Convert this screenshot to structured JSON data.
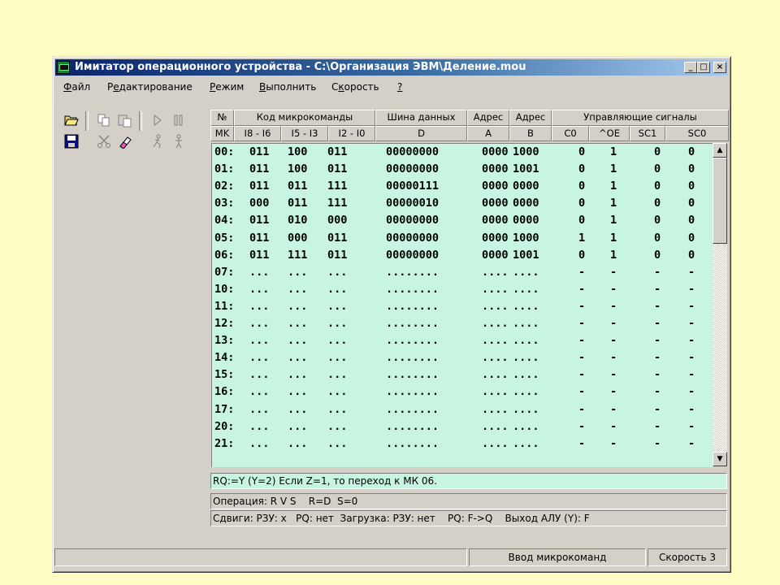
{
  "window": {
    "title": "Имитатор операционного устройства - C:\\Организация ЭВМ\\Деление.mou",
    "minimize": "_",
    "maximize": "□",
    "close": "×"
  },
  "menu": [
    {
      "accel": "Ф",
      "rest": "айл"
    },
    {
      "accel": "",
      "pre": "Р",
      "u": "е",
      "rest": "дактирование"
    },
    {
      "accel": "Р",
      "rest": "ежим"
    },
    {
      "accel": "В",
      "rest": "ыполнить"
    },
    {
      "accel": "",
      "pre": "С",
      "u": "к",
      "rest": "орость"
    },
    {
      "accel": "?",
      "rest": ""
    }
  ],
  "toolbar": {
    "icons": [
      "open-folder-icon",
      "copy-icon",
      "paste-icon",
      "play-icon",
      "pause-icon",
      "save-icon",
      "cut-icon",
      "eraser-icon",
      "step-icon",
      "step-back-icon"
    ]
  },
  "headers": {
    "row1": [
      "№",
      "Код микрокоманды",
      "Шина данных",
      "Адрес",
      "Адрес",
      "Управляющие сигналы"
    ],
    "row2": [
      "MK",
      "I8 - I6",
      "I5 - I3",
      "I2 - I0",
      "D",
      "A",
      "B",
      "C0",
      "^OE",
      "SC1",
      "SC0"
    ]
  },
  "rows": [
    [
      "00:",
      "011",
      "100",
      "011",
      "00000000",
      "0000",
      "1000",
      "0",
      "1",
      "0",
      "0"
    ],
    [
      "01:",
      "011",
      "100",
      "011",
      "00000000",
      "0000",
      "1001",
      "0",
      "1",
      "0",
      "0"
    ],
    [
      "02:",
      "011",
      "011",
      "111",
      "00000111",
      "0000",
      "0000",
      "0",
      "1",
      "0",
      "0"
    ],
    [
      "03:",
      "000",
      "011",
      "111",
      "00000010",
      "0000",
      "0000",
      "0",
      "1",
      "0",
      "0"
    ],
    [
      "04:",
      "011",
      "010",
      "000",
      "00000000",
      "0000",
      "0000",
      "0",
      "1",
      "0",
      "0"
    ],
    [
      "05:",
      "011",
      "000",
      "011",
      "00000000",
      "0000",
      "1000",
      "1",
      "1",
      "0",
      "0"
    ],
    [
      "06:",
      "011",
      "111",
      "011",
      "00000000",
      "0000",
      "1001",
      "0",
      "1",
      "0",
      "0"
    ],
    [
      "07:",
      "...",
      "...",
      "...",
      "........",
      "....",
      "....",
      "-",
      "-",
      "-",
      "-"
    ],
    [
      "10:",
      "...",
      "...",
      "...",
      "........",
      "....",
      "....",
      "-",
      "-",
      "-",
      "-"
    ],
    [
      "11:",
      "...",
      "...",
      "...",
      "........",
      "....",
      "....",
      "-",
      "-",
      "-",
      "-"
    ],
    [
      "12:",
      "...",
      "...",
      "...",
      "........",
      "....",
      "....",
      "-",
      "-",
      "-",
      "-"
    ],
    [
      "13:",
      "...",
      "...",
      "...",
      "........",
      "....",
      "....",
      "-",
      "-",
      "-",
      "-"
    ],
    [
      "14:",
      "...",
      "...",
      "...",
      "........",
      "....",
      "....",
      "-",
      "-",
      "-",
      "-"
    ],
    [
      "15:",
      "...",
      "...",
      "...",
      "........",
      "....",
      "....",
      "-",
      "-",
      "-",
      "-"
    ],
    [
      "16:",
      "...",
      "...",
      "...",
      "........",
      "....",
      "....",
      "-",
      "-",
      "-",
      "-"
    ],
    [
      "17:",
      "...",
      "...",
      "...",
      "........",
      "....",
      "....",
      "-",
      "-",
      "-",
      "-"
    ],
    [
      "20:",
      "...",
      "...",
      "...",
      "........",
      "....",
      "....",
      "-",
      "-",
      "-",
      "-"
    ],
    [
      "21:",
      "...",
      "...",
      "...",
      "........",
      "....",
      "....",
      "-",
      "-",
      "-",
      "-"
    ]
  ],
  "info": {
    "comment": "RQ:=Y (Y=2) Если Z=1, то переход к МК 06.",
    "operation": "Операция: R V S    R=D  S=0",
    "shifts": "Сдвиги: РЗУ: x   PQ: нет  Загрузка: РЗУ: нет    PQ: F->Q    Выход АЛУ (Y): F"
  },
  "status": {
    "left": "",
    "mode": "Ввод микрокоманд",
    "speed": "Скорость 3"
  },
  "colors": {
    "background": "#fdfdc4",
    "grid": "#c8f5e2",
    "window": "#d4d0c8",
    "title_start": "#0a246a"
  }
}
